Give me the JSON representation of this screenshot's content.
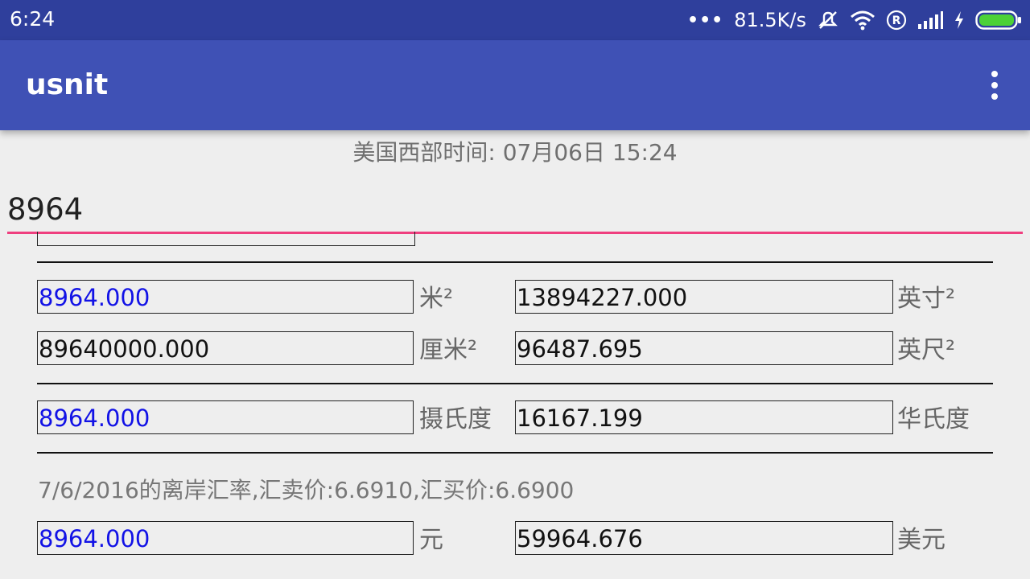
{
  "status_bar": {
    "time": "6:24",
    "network_speed": "81.5K/s",
    "icons": [
      "more-dots-icon",
      "mute-icon",
      "wifi-icon",
      "registered-icon",
      "signal-icon",
      "charging-icon",
      "battery-icon"
    ]
  },
  "app_bar": {
    "title": "usnit",
    "menu_icon": "overflow-menu-icon"
  },
  "clock_label": "美国西部时间: 07月06日 15:24",
  "input": {
    "value": "8964"
  },
  "area": {
    "row1": {
      "left_value": "8964.000",
      "left_unit": "米²",
      "right_value": "13894227.000",
      "right_unit": "英寸²"
    },
    "row2": {
      "left_value": "89640000.000",
      "left_unit": "厘米²",
      "right_value": "96487.695",
      "right_unit": "英尺²"
    }
  },
  "temperature": {
    "left_value": "8964.000",
    "left_unit": "摄氏度",
    "right_value": "16167.199",
    "right_unit": "华氏度"
  },
  "exchange_rate_label": "7/6/2016的离岸汇率,汇卖价:6.6910,汇买价:6.6900",
  "currency": {
    "left_value": "8964.000",
    "left_unit": "元",
    "right_value": "59964.676",
    "right_unit": "美元"
  },
  "colors": {
    "status_bar": "#2f3f9c",
    "app_bar": "#3f51b5",
    "input_underline": "#ef3f7f",
    "source_value": "#1212e6",
    "battery": "#4cd137"
  }
}
